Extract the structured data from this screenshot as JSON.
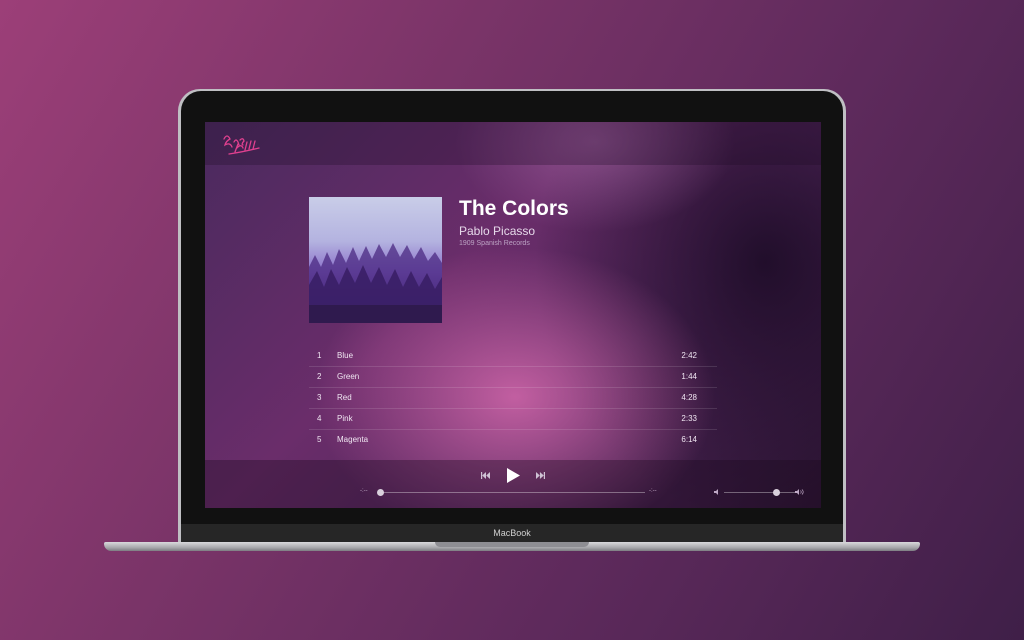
{
  "device": {
    "brand": "MacBook"
  },
  "app": {
    "logo": "Bass Jams"
  },
  "album": {
    "title": "The Colors",
    "artist": "Pablo Picasso",
    "label": "1909 Spanish Records",
    "art": "foggy-purple-forest-image"
  },
  "tracks": [
    {
      "num": "1",
      "name": "Blue",
      "duration": "2:42"
    },
    {
      "num": "2",
      "name": "Green",
      "duration": "1:44"
    },
    {
      "num": "3",
      "name": "Red",
      "duration": "4:28"
    },
    {
      "num": "4",
      "name": "Pink",
      "duration": "2:33"
    },
    {
      "num": "5",
      "name": "Magenta",
      "duration": "6:14"
    }
  ],
  "player": {
    "elapsed": "-:--",
    "total": "-:--",
    "progress": 0,
    "volume": 0.75,
    "icons": {
      "prev": "previous-icon",
      "play": "play-icon",
      "next": "next-icon",
      "vol_low": "volume-low-icon",
      "vol_high": "volume-high-icon"
    }
  },
  "colors": {
    "logo": "#e0408f",
    "text": "#ffffff"
  }
}
